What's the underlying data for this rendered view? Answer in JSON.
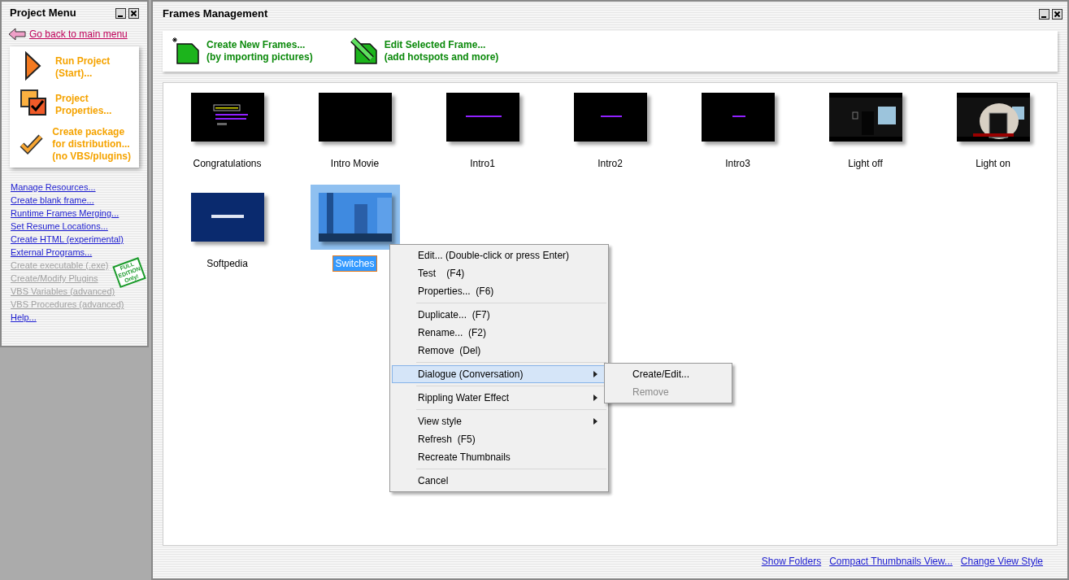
{
  "project_menu": {
    "title": "Project Menu",
    "back_link": "Go back to main menu",
    "actions": [
      {
        "kind": "run",
        "label": "Run Project\n(Start)..."
      },
      {
        "kind": "properties",
        "label": "Project\nProperties..."
      },
      {
        "kind": "package",
        "label": "Create package\nfor distribution...\n(no VBS/plugins)"
      }
    ],
    "links": [
      {
        "label": "Manage Resources...",
        "disabled": false
      },
      {
        "label": "Create blank frame...",
        "disabled": false
      },
      {
        "label": "Runtime Frames Merging...",
        "disabled": false
      },
      {
        "label": "Set Resume Locations...",
        "disabled": false
      },
      {
        "label": "Create HTML (experimental)",
        "disabled": false
      },
      {
        "label": "External Programs...",
        "disabled": false
      },
      {
        "label": "Create executable (.exe)",
        "disabled": true
      },
      {
        "label": "Create/Modify Plugins",
        "disabled": true
      },
      {
        "label": "VBS Variables (advanced)",
        "disabled": true
      },
      {
        "label": "VBS Procedures (advanced)",
        "disabled": true
      },
      {
        "label": "Help...",
        "disabled": false
      }
    ],
    "stamp": "FULL\nEDITION\nOnly!"
  },
  "frames_window": {
    "title": "Frames Management",
    "toolbar": [
      {
        "kind": "create",
        "label": "Create New Frames...\n(by importing pictures)"
      },
      {
        "kind": "edit",
        "label": "Edit Selected Frame...\n(add hotspots and more)"
      }
    ],
    "frames": [
      {
        "label": "Congratulations",
        "selected": false
      },
      {
        "label": "Intro Movie",
        "selected": false
      },
      {
        "label": "Intro1",
        "selected": false
      },
      {
        "label": "Intro2",
        "selected": false
      },
      {
        "label": "Intro3",
        "selected": false
      },
      {
        "label": "Light off",
        "selected": false
      },
      {
        "label": "Light on",
        "selected": false
      },
      {
        "label": "Softpedia",
        "selected": false
      },
      {
        "label": "Switches",
        "selected": true
      }
    ],
    "context_menu": [
      {
        "kind": "item",
        "label": "Edit... (Double-click or press Enter)",
        "selected": false,
        "submenu": false
      },
      {
        "kind": "item",
        "label": "Test    (F4)",
        "selected": false,
        "submenu": false
      },
      {
        "kind": "item",
        "label": "Properties...  (F6)",
        "selected": false,
        "submenu": false
      },
      {
        "kind": "separator"
      },
      {
        "kind": "item",
        "label": "Duplicate...  (F7)",
        "selected": false,
        "submenu": false
      },
      {
        "kind": "item",
        "label": "Rename...  (F2)",
        "selected": false,
        "submenu": false
      },
      {
        "kind": "item",
        "label": "Remove  (Del)",
        "selected": false,
        "submenu": false
      },
      {
        "kind": "separator"
      },
      {
        "kind": "item",
        "label": "Dialogue (Conversation)",
        "selected": true,
        "submenu": true
      },
      {
        "kind": "separator"
      },
      {
        "kind": "item",
        "label": "Rippling Water Effect",
        "selected": false,
        "submenu": true
      },
      {
        "kind": "separator"
      },
      {
        "kind": "item",
        "label": "View style",
        "selected": false,
        "submenu": true
      },
      {
        "kind": "item",
        "label": "Refresh  (F5)",
        "selected": false,
        "submenu": false
      },
      {
        "kind": "item",
        "label": "Recreate Thumbnails",
        "selected": false,
        "submenu": false
      },
      {
        "kind": "separator"
      },
      {
        "kind": "item",
        "label": "Cancel",
        "selected": false,
        "submenu": false
      }
    ],
    "submenu": [
      {
        "label": "Create/Edit...",
        "disabled": false
      },
      {
        "label": "Remove",
        "disabled": true
      }
    ],
    "footer_links": [
      "Show Folders",
      "Compact Thumbnails View...",
      "Change View Style"
    ]
  }
}
